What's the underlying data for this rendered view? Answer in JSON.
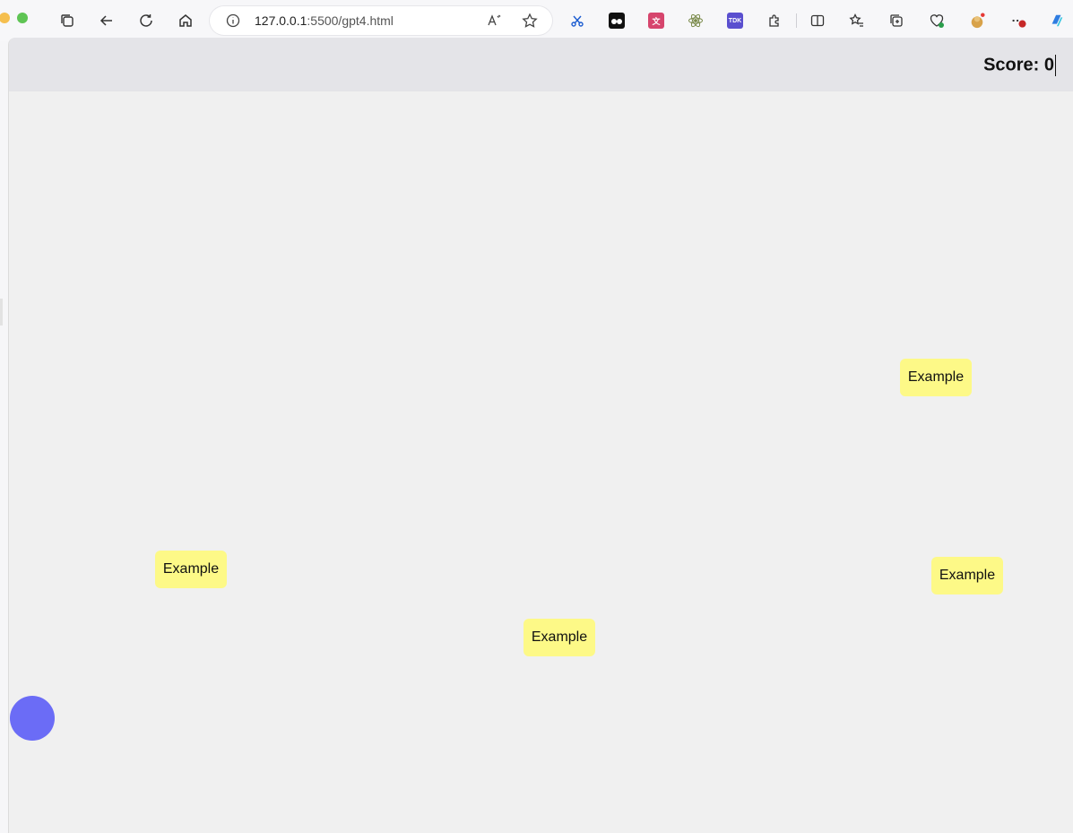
{
  "browser": {
    "url_host": "127.0.0.1",
    "url_rest": ":5500/gpt4.html",
    "traffic_colors": {
      "yellow": "#f5bf4f",
      "green": "#5fc454"
    },
    "icons": [
      "tabs-icon",
      "back-icon",
      "refresh-icon",
      "home-icon",
      "info-icon",
      "read-aloud-icon",
      "favorite-star-icon",
      "scissors-extension-icon",
      "tampermonkey-extension-icon",
      "translate-extension-icon",
      "react-devtools-extension-icon",
      "tdk-extension-icon",
      "extensions-puzzle-icon",
      "split-screen-icon",
      "favorites-list-icon",
      "collections-icon",
      "browser-essentials-icon",
      "profile-avatar-icon",
      "more-menu-icon",
      "copilot-icon"
    ],
    "tdk_label": "TDK",
    "more_badge": "1"
  },
  "game": {
    "score_label": "Score: 0",
    "targets": [
      {
        "label": "Example"
      },
      {
        "label": "Example"
      },
      {
        "label": "Example"
      },
      {
        "label": "Example"
      }
    ],
    "colors": {
      "target_bg": "#fdf987",
      "player": "#6b6cf6",
      "header_bg": "#e4e4e8",
      "canvas_bg": "#f0f0f0"
    }
  }
}
